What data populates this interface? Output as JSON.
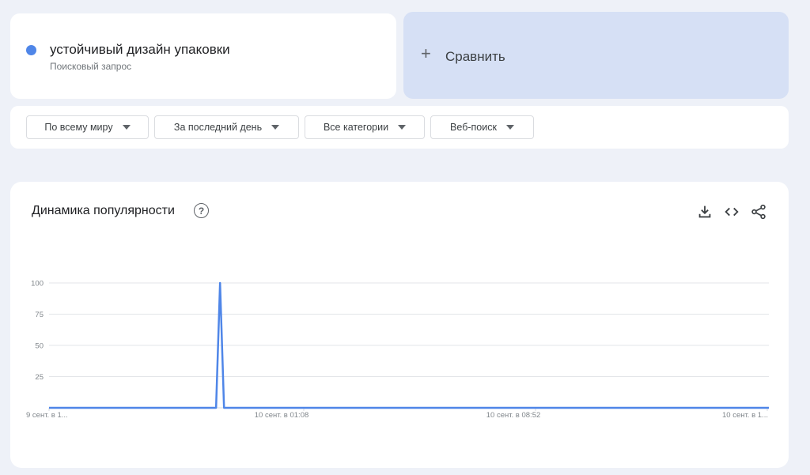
{
  "search_term": {
    "label": "устойчивый дизайн упаковки",
    "type": "Поисковый запрос",
    "color": "#4f86e8"
  },
  "compare": {
    "plus_icon": "plus-icon",
    "label": "Сравнить"
  },
  "filters": [
    {
      "label": "По всему миру"
    },
    {
      "label": "За последний день"
    },
    {
      "label": "Все категории"
    },
    {
      "label": "Веб-поиск"
    }
  ],
  "interest_card": {
    "title": "Динамика популярности",
    "help_icon": "help-icon",
    "tools": [
      "download-icon",
      "embed-code-icon",
      "share-icon"
    ]
  },
  "chart_data": {
    "type": "line",
    "title": "Динамика популярности",
    "ylim": [
      0,
      100
    ],
    "yticks": [
      25,
      50,
      75,
      100
    ],
    "xtick_labels": [
      "9 сент. в 1...",
      "10 сент. в 01:08",
      "10 сент. в 08:52",
      "10 сент. в 1..."
    ],
    "grid": true,
    "series": [
      {
        "name": "устойчивый дизайн упаковки",
        "color": "#4f86e8",
        "values": [
          0,
          0,
          0,
          0,
          0,
          0,
          0,
          0,
          0,
          0,
          0,
          0,
          0,
          0,
          0,
          0,
          0,
          0,
          0,
          0,
          0,
          0,
          0,
          0,
          0,
          0,
          0,
          0,
          0,
          0,
          0,
          0,
          0,
          0,
          0,
          0,
          0,
          0,
          0,
          0,
          0,
          0,
          0,
          100,
          0,
          0,
          0,
          0,
          0,
          0,
          0,
          0,
          0,
          0,
          0,
          0,
          0,
          0,
          0,
          0,
          0,
          0,
          0,
          0,
          0,
          0,
          0,
          0,
          0,
          0,
          0,
          0,
          0,
          0,
          0,
          0,
          0,
          0,
          0,
          0,
          0,
          0,
          0,
          0,
          0,
          0,
          0,
          0,
          0,
          0,
          0,
          0,
          0,
          0,
          0,
          0,
          0,
          0,
          0,
          0,
          0,
          0,
          0,
          0,
          0,
          0,
          0,
          0,
          0,
          0,
          0,
          0,
          0,
          0,
          0,
          0,
          0,
          0,
          0,
          0,
          0,
          0,
          0,
          0,
          0,
          0,
          0,
          0,
          0,
          0,
          0,
          0,
          0,
          0,
          0,
          0,
          0,
          0,
          0,
          0,
          0,
          0,
          0,
          0,
          0,
          0,
          0,
          0,
          0,
          0,
          0,
          0,
          0,
          0,
          0,
          0,
          0,
          0,
          0,
          0,
          0,
          0,
          0,
          0,
          0,
          0,
          0,
          0,
          0,
          0,
          0,
          0,
          0,
          0,
          0,
          0,
          0,
          0,
          0,
          0,
          0,
          0
        ]
      }
    ]
  }
}
